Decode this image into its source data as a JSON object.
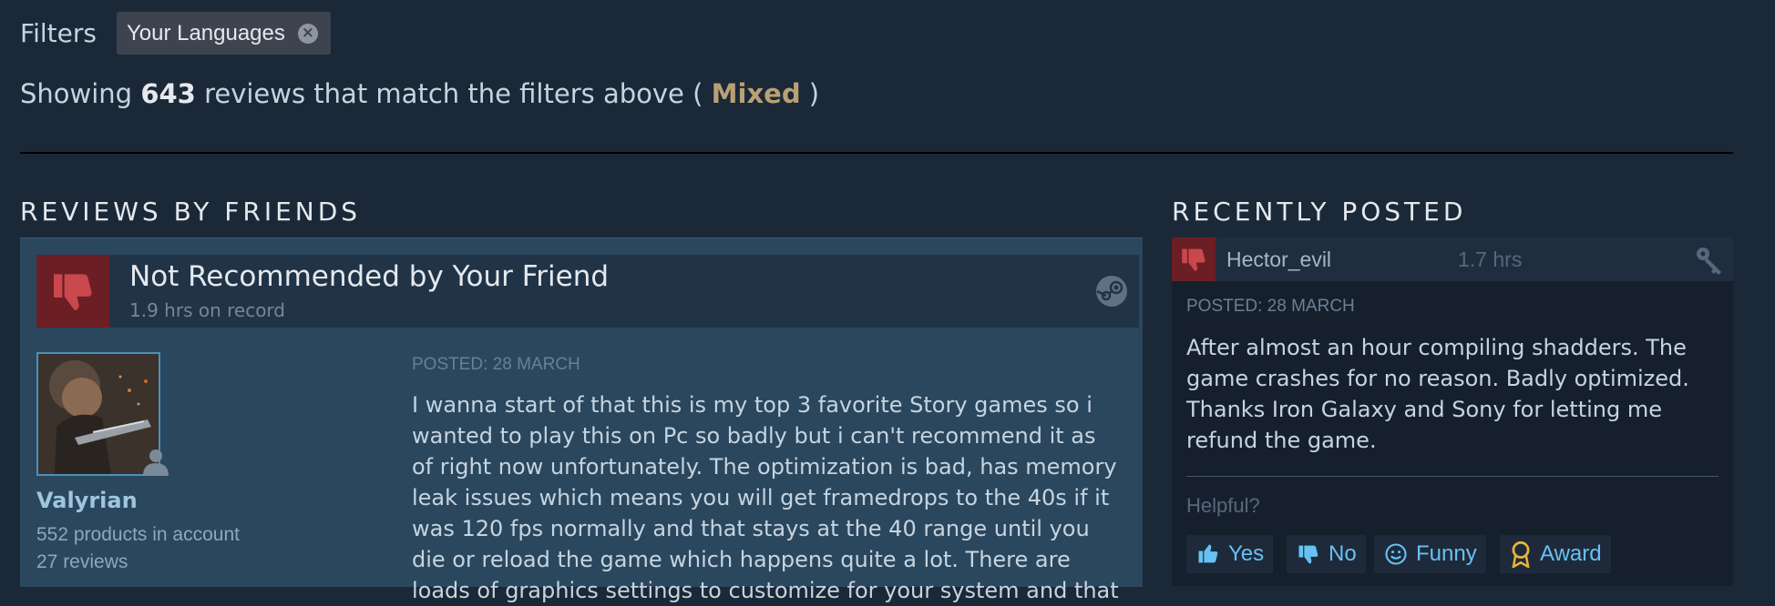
{
  "filters": {
    "label": "Filters",
    "chip_label": "Your Languages",
    "chip_close_glyph": "×"
  },
  "summary": {
    "prefix": "Showing ",
    "count": "643",
    "middle": " reviews that match the filters above ( ",
    "rating": "Mixed",
    "suffix": " )"
  },
  "friends_section": {
    "title": "REVIEWS BY FRIENDS",
    "review": {
      "heading": "Not Recommended by Your Friend",
      "hours": "1.9 hrs on record",
      "username": "Valyrian",
      "products": "552 products in account",
      "reviews_count": "27 reviews",
      "posted": "POSTED: 28 MARCH",
      "text_lines": [
        "I wanna start of that this is my top 3 favorite Story games so i",
        "wanted to play this on Pc so badly but i can't recommend it as",
        "of right now unfortunately. The optimization is bad, has memory",
        "leak issues which means you will get framedrops to the 40s if it",
        "was 120 fps normally and that stays at the 40 range until you",
        "die or reload the game which happens quite a lot. There are",
        "loads of graphics settings to customize for your system and that"
      ]
    }
  },
  "recent_section": {
    "title": "RECENTLY POSTED",
    "review": {
      "username": "Hector_evil",
      "hours": "1.7 hrs",
      "posted": "POSTED: 28 MARCH",
      "text_lines": [
        "After almost an hour compiling shadders. The",
        "game crashes for no reason. Badly optimized.",
        "Thanks Iron Galaxy and Sony for letting me",
        "refund the game."
      ],
      "helpful_label": "Helpful?",
      "buttons": {
        "yes": "Yes",
        "no": "No",
        "funny": "Funny",
        "award": "Award"
      }
    }
  },
  "colors": {
    "background": "#1b2838",
    "mixed_rating": "#b9a074",
    "thumbs_down": "#c8484d",
    "link_blue": "#67c1f5",
    "friend_panel": "#2a475e"
  },
  "icons": {
    "thumbs_down": "thumbs-down-icon",
    "steam": "steam-logo-icon",
    "key": "key-icon",
    "friend": "friend-person-icon",
    "yes": "thumbs-up-icon",
    "no": "thumbs-down-icon",
    "funny": "smiley-icon",
    "award": "award-icon"
  }
}
